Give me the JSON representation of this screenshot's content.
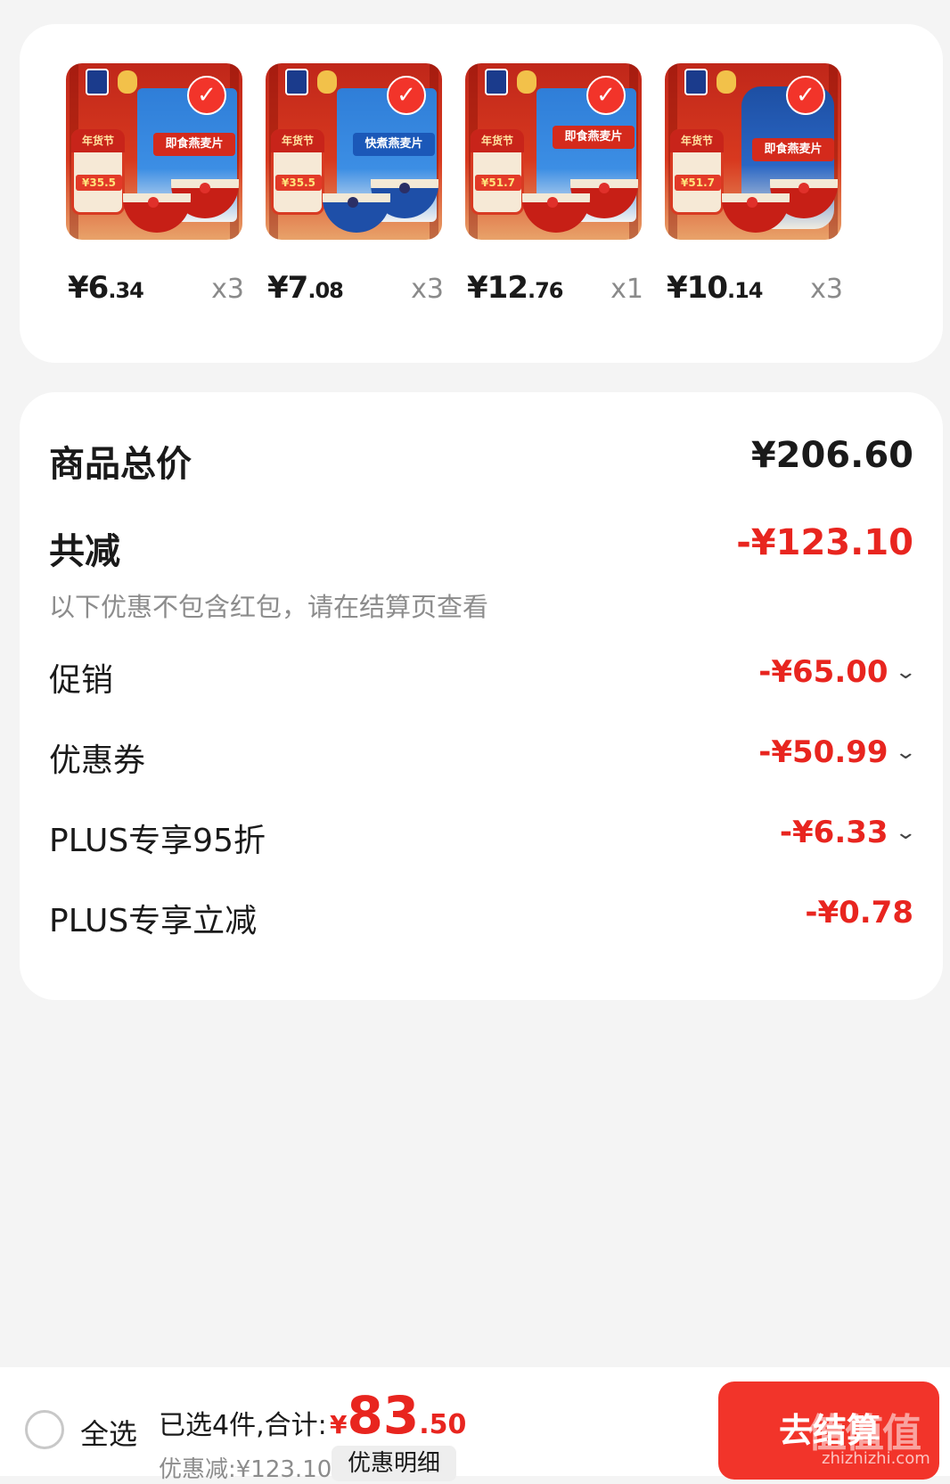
{
  "products": [
    {
      "pack_label": "即食燕麦片",
      "promo_title": "年货节",
      "promo_price": "¥35.5",
      "price_int": "¥6",
      "price_dec": ".34",
      "qty": "x3",
      "variant": "bag-red"
    },
    {
      "pack_label": "快煮燕麦片",
      "promo_title": "年货节",
      "promo_price": "¥35.5",
      "price_int": "¥7",
      "price_dec": ".08",
      "qty": "x3",
      "variant": "bag-blue"
    },
    {
      "pack_label": "即食燕麦片",
      "promo_title": "年货节",
      "promo_price": "¥51.7",
      "price_int": "¥12",
      "price_dec": ".76",
      "qty": "x1",
      "variant": "bag-red"
    },
    {
      "pack_label": "即食燕麦片",
      "promo_title": "年货节",
      "promo_price": "¥51.7",
      "price_int": "¥10",
      "price_dec": ".14",
      "qty": "x3",
      "variant": "jar"
    }
  ],
  "summary": {
    "total_label": "商品总价",
    "total_value": "¥206.60",
    "discount_label": "共减",
    "discount_value": "-¥123.10",
    "note": "以下优惠不包含红包，请在结算页查看",
    "items": [
      {
        "label": "促销",
        "value": "-¥65.00",
        "expandable": true
      },
      {
        "label": "优惠券",
        "value": "-¥50.99",
        "expandable": true
      },
      {
        "label": "PLUS专享95折",
        "value": "-¥6.33",
        "expandable": true
      },
      {
        "label": "PLUS专享立减",
        "value": "-¥0.78",
        "expandable": false
      }
    ]
  },
  "bottom": {
    "select_all": "全选",
    "selected_text": "已选4件,合计:",
    "total_currency": "¥",
    "total_int": "83",
    "total_dec": ".50",
    "saved_text": "优惠减:¥123.10",
    "detail_button": "优惠明细",
    "checkout_button": "去结算"
  },
  "watermark": {
    "text": "值值值",
    "url": "zhizhizhi.com"
  },
  "colors": {
    "accent": "#e8251f",
    "background": "#f4f4f4",
    "card": "#ffffff",
    "muted": "#8c8c8c"
  }
}
